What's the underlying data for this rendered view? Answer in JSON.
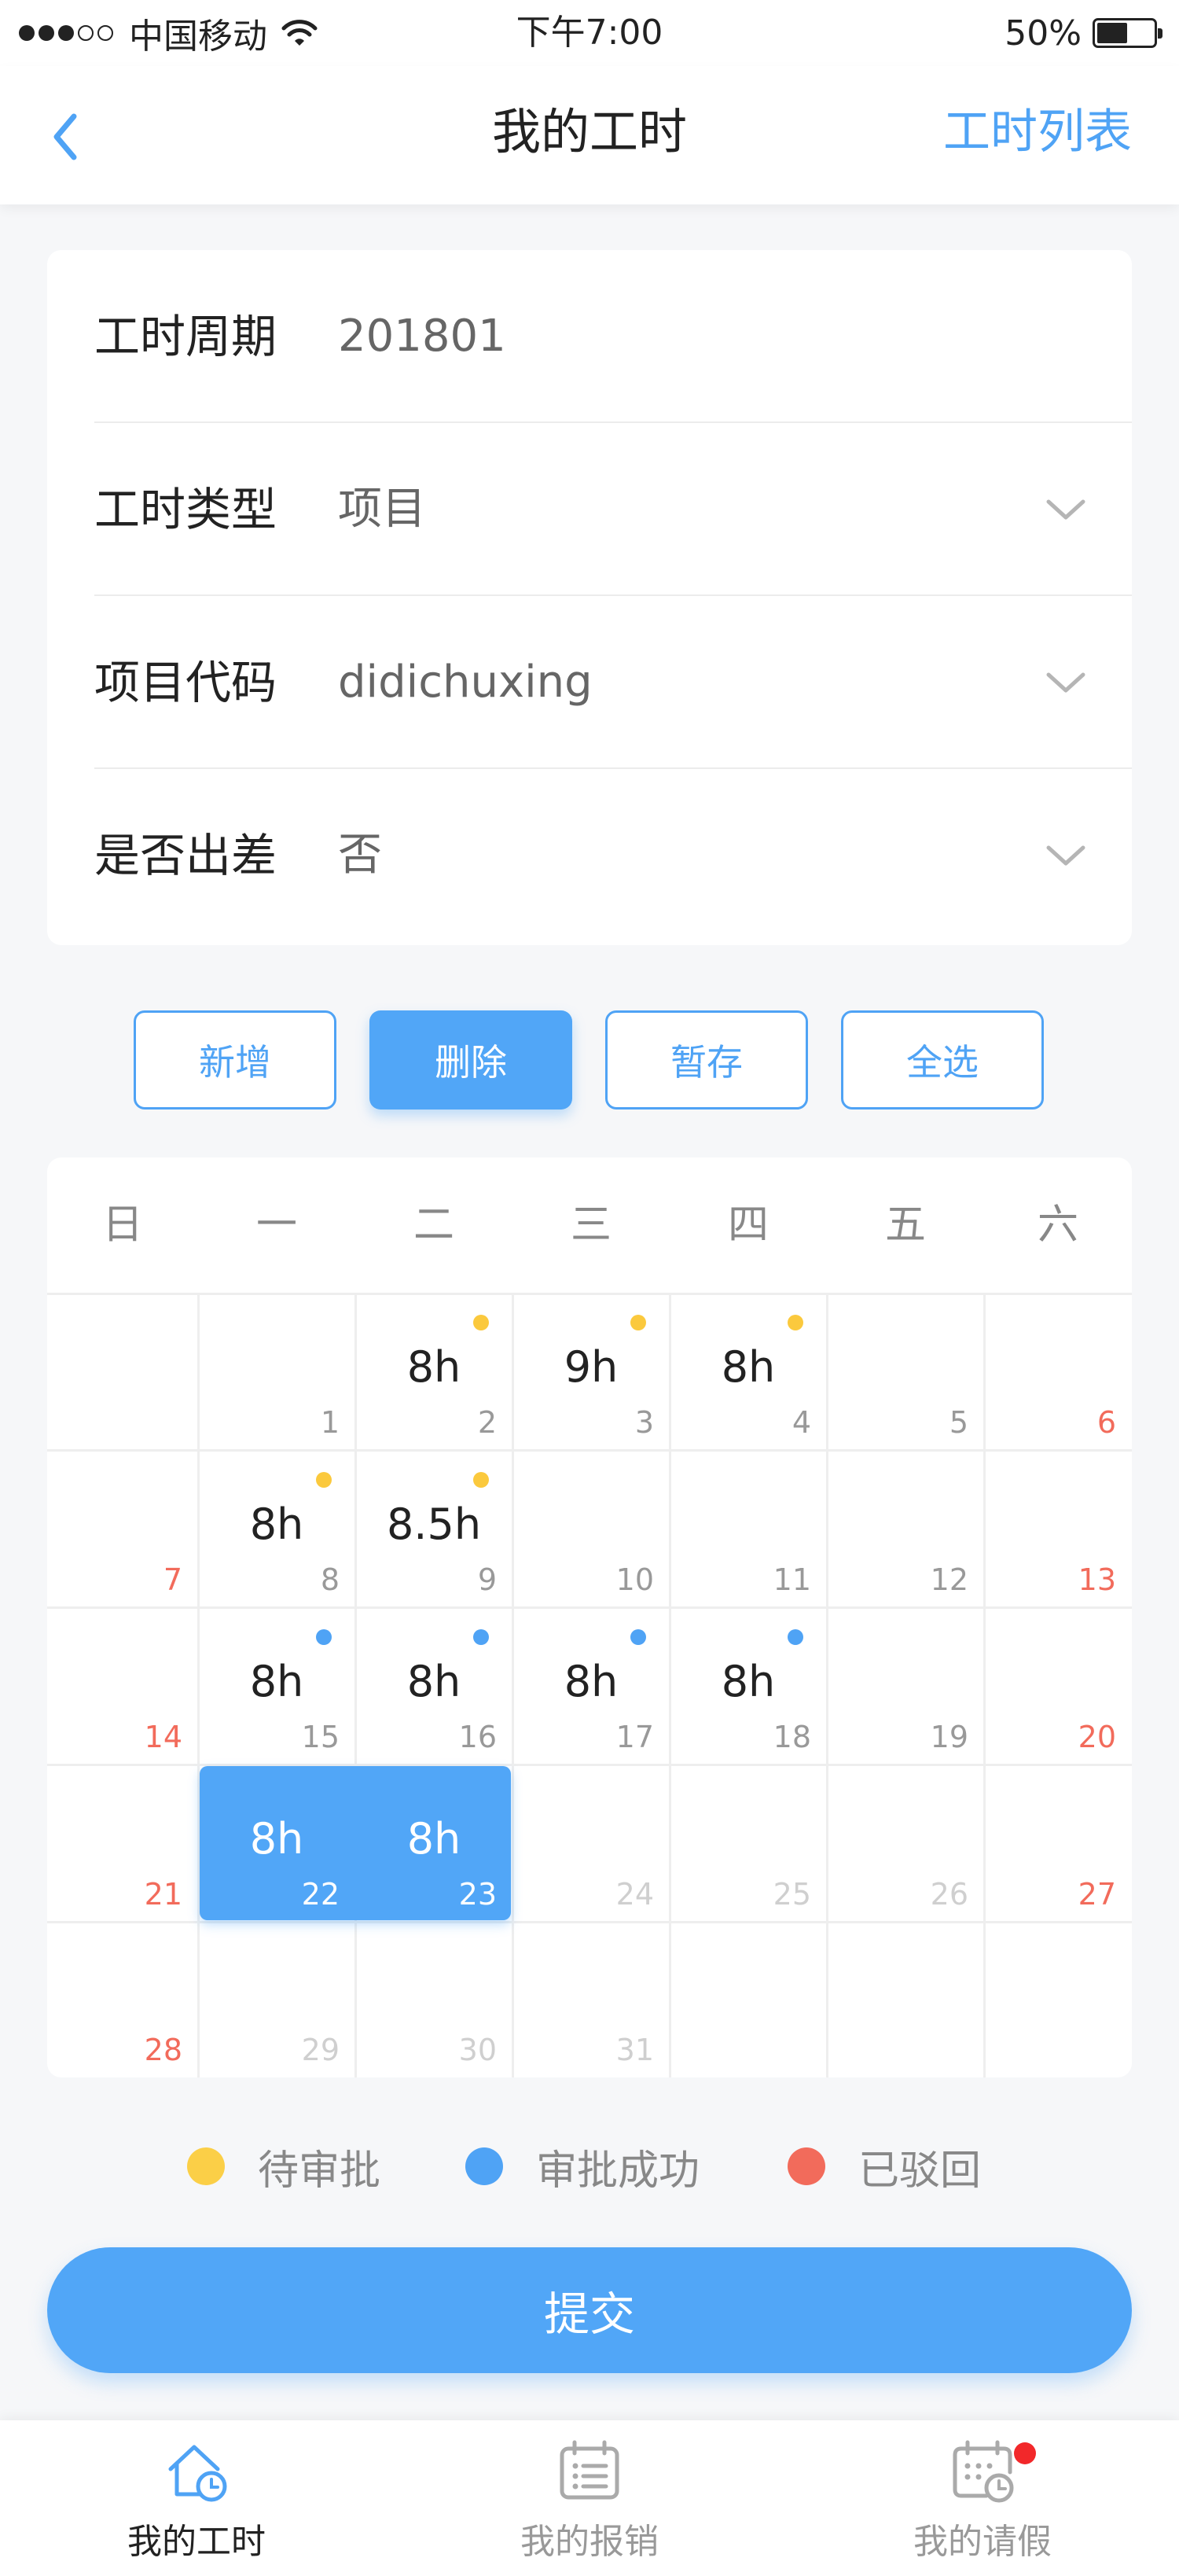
{
  "status_bar": {
    "carrier": "中国移动",
    "time": "下午7:00",
    "battery": "50%",
    "battery_level": 0.5,
    "signal_bars": 3
  },
  "nav": {
    "title": "我的工时",
    "right_action": "工时列表",
    "back_icon": "chevron-left-icon"
  },
  "form": {
    "rows": [
      {
        "label": "工时周期",
        "value": "201801",
        "has_dropdown": false
      },
      {
        "label": "工时类型",
        "value": "项目",
        "has_dropdown": true
      },
      {
        "label": "项目代码",
        "value": "didichuxing",
        "has_dropdown": true
      },
      {
        "label": "是否出差",
        "value": "否",
        "has_dropdown": true
      }
    ]
  },
  "actions": {
    "add": "新增",
    "delete": "删除",
    "save_draft": "暂存",
    "select_all": "全选"
  },
  "calendar": {
    "weekdays": [
      "日",
      "一",
      "二",
      "三",
      "四",
      "五",
      "六"
    ],
    "weeks": [
      [
        null,
        {
          "day": "1"
        },
        {
          "day": "2",
          "hours": "8h",
          "status": "pending"
        },
        {
          "day": "3",
          "hours": "9h",
          "status": "pending"
        },
        {
          "day": "4",
          "hours": "8h",
          "status": "pending"
        },
        {
          "day": "5"
        },
        {
          "day": "6"
        }
      ],
      [
        {
          "day": "7"
        },
        {
          "day": "8",
          "hours": "8h",
          "status": "pending"
        },
        {
          "day": "9",
          "hours": "8.5h",
          "status": "pending"
        },
        {
          "day": "10"
        },
        {
          "day": "11"
        },
        {
          "day": "12"
        },
        {
          "day": "13"
        }
      ],
      [
        {
          "day": "14"
        },
        {
          "day": "15",
          "hours": "8h",
          "status": "approved"
        },
        {
          "day": "16",
          "hours": "8h",
          "status": "approved"
        },
        {
          "day": "17",
          "hours": "8h",
          "status": "approved"
        },
        {
          "day": "18",
          "hours": "8h",
          "status": "approved"
        },
        {
          "day": "19"
        },
        {
          "day": "20"
        }
      ],
      [
        {
          "day": "21"
        },
        {
          "day": "22",
          "hours": "8h",
          "selected": true
        },
        {
          "day": "23",
          "hours": "8h",
          "selected": true
        },
        {
          "day": "24",
          "future": true
        },
        {
          "day": "25",
          "future": true
        },
        {
          "day": "26",
          "future": true
        },
        {
          "day": "27"
        }
      ],
      [
        {
          "day": "28"
        },
        {
          "day": "29",
          "future": true
        },
        {
          "day": "30",
          "future": true
        },
        {
          "day": "31",
          "future": true
        },
        null,
        null,
        null
      ]
    ]
  },
  "legend": [
    {
      "label": "待审批",
      "color": "#fbcf47"
    },
    {
      "label": "审批成功",
      "color": "#4fa3f5"
    },
    {
      "label": "已驳回",
      "color": "#f26b5b"
    }
  ],
  "submit_label": "提交",
  "tabbar": {
    "tabs": [
      {
        "label": "我的工时",
        "icon": "home-clock-icon",
        "active": true
      },
      {
        "label": "我的报销",
        "icon": "calendar-list-icon",
        "active": false
      },
      {
        "label": "我的请假",
        "icon": "calendar-clock-icon",
        "active": false,
        "badge": true
      }
    ]
  },
  "colors": {
    "accent": "#4fa3f5",
    "weekend": "#f26b5b",
    "pending": "#fbc93d",
    "badge": "#f2282a"
  }
}
